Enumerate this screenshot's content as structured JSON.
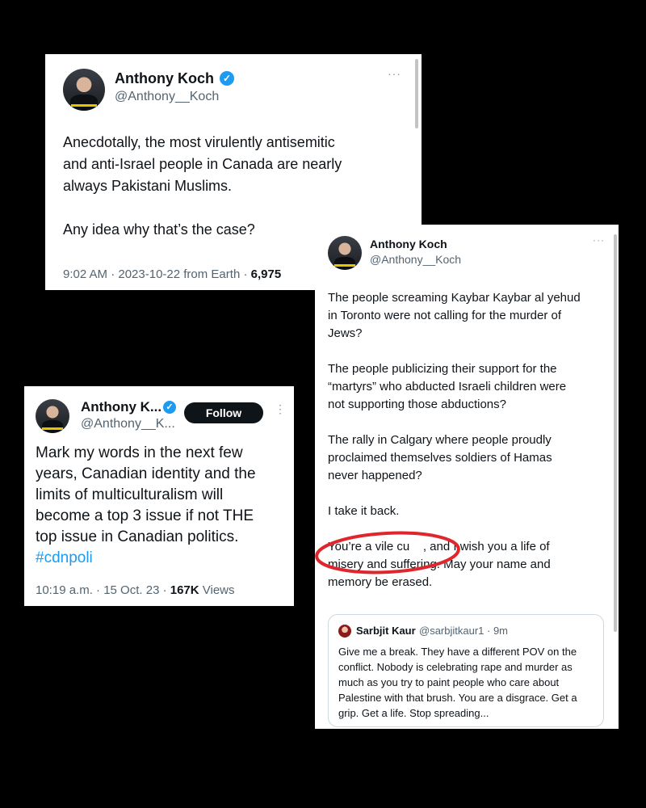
{
  "tweet_a": {
    "name": "Anthony Koch",
    "handle": "@Anthony__Koch",
    "more": "···",
    "text": "Anecdotally, the most virulently antisemitic\nand anti-Israel people in Canada are nearly\nalways Pakistani Muslims.\n\nAny idea why that’s the case?",
    "meta_time": "9:02 AM · 2023-10-22 from Earth · ",
    "meta_views": "6,975"
  },
  "tweet_b": {
    "name": "Anthony Koch",
    "handle": "@Anthony__Koch",
    "more": "···",
    "text": "The people screaming Kaybar Kaybar al yehud\nin Toronto were not calling for the murder of\nJews?\n\nThe people publicizing their support for the\n“martyrs” who abducted Israeli children were\nnot supporting those abductions?\n\nThe rally in Calgary where people proudly\nproclaimed themselves soldiers of Hamas\nnever happened?\n\nI take it back.\n\nYou’re a vile cu    , and I wish you a life of\nmisery and suffering. May your name and\nmemory be erased.",
    "quote": {
      "name": "Sarbjit Kaur",
      "handle": "@sarbjitkaur1 · 9m",
      "text": "Give me a break. They have a different POV on the conflict. Nobody is celebrating rape and murder as much as you try to paint people who care about Palestine with that brush. You are a disgrace. Get a grip. Get a life. Stop spreading..."
    },
    "annotation_color": "#e0262d"
  },
  "tweet_c": {
    "name": "Anthony K...",
    "handle": "@Anthony__K...",
    "follow_label": "Follow",
    "more": "⋮",
    "text": "Mark my words in the next few\nyears, Canadian identity and the\nlimits of multiculturalism will\nbecome a top 3 issue if not THE\ntop issue in Canadian politics.",
    "hashtag": "#cdnpoli",
    "meta_time": "10:19 a.m. · 15 Oct. 23 · ",
    "meta_views_count": "167K",
    "meta_views_label": " Views"
  },
  "colors": {
    "background": "#000000",
    "link": "#1d9bf0",
    "verified": "#1d9bf0",
    "follow_button": "#0f1419"
  }
}
